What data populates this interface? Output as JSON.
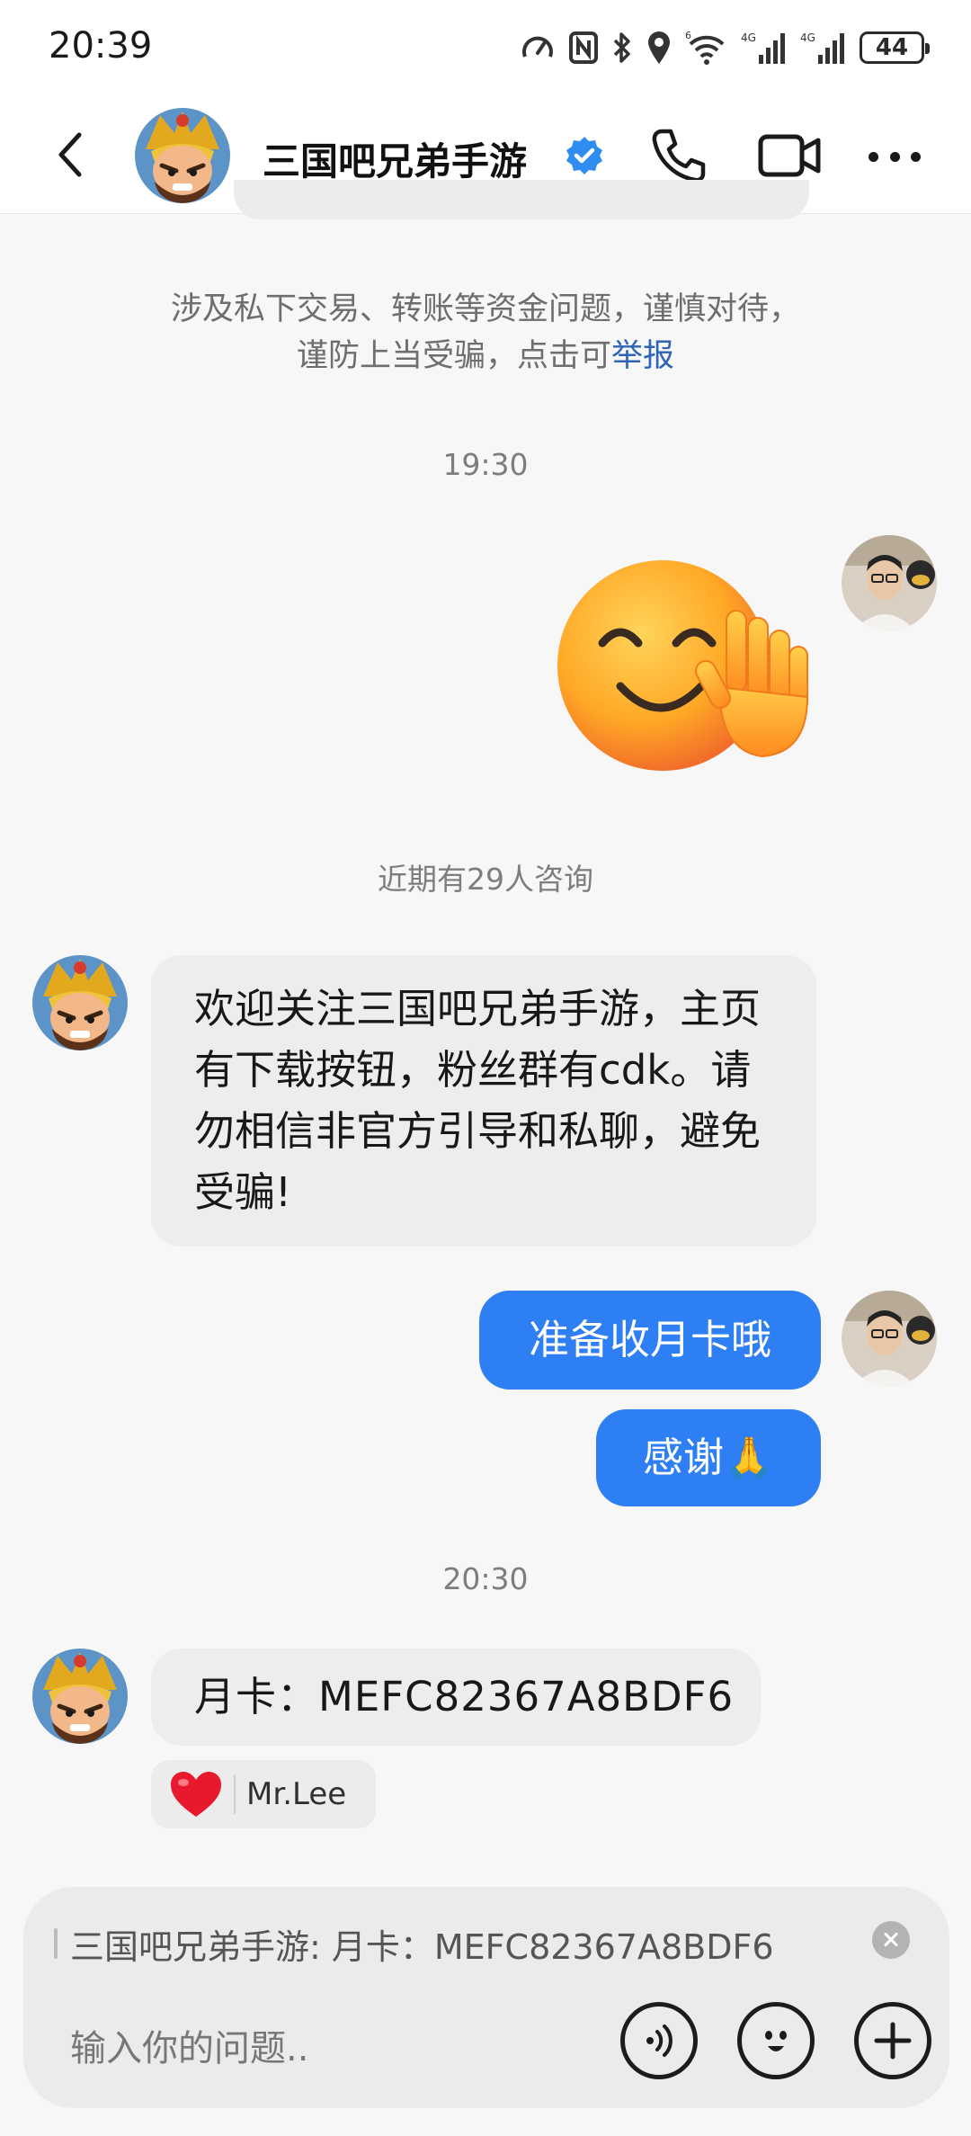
{
  "status_bar": {
    "time": "20:39",
    "network_1": "4G",
    "network_2": "4G",
    "wifi_badge": "6",
    "battery": "44",
    "icons": [
      "speed-icon",
      "nfc-icon",
      "bluetooth-icon",
      "location-icon",
      "wifi-icon",
      "signal-icon",
      "signal-icon",
      "battery-icon"
    ]
  },
  "header": {
    "title": "三国吧兄弟手游",
    "verified_color": "#2f8cf0",
    "icons": [
      "back-arrow-icon",
      "verified-badge-icon",
      "phone-call-icon",
      "video-call-icon",
      "more-dots-icon"
    ]
  },
  "chat": {
    "notice_text": "涉及私下交易、转账等资金问题，谨慎对待，谨防上当受骗，点击可",
    "notice_link": "举报",
    "timestamp_1": "19:30",
    "sticker": "waving-smile-emoji",
    "consult_note": "近期有29人咨询",
    "welcome_message": "欢迎关注三国吧兄弟手游，主页有下载按钮，粉丝群有cdk。请勿相信非官方引导和私聊，避免受骗!",
    "sent_message_1": "准备收月卡哦",
    "sent_message_2": "感谢🙏",
    "timestamp_2": "20:30",
    "code_message": "月卡：MEFC82367A8BDF6",
    "reaction": {
      "emoji": "heart-icon",
      "user": "Mr.Lee"
    },
    "accent_color": "#2d7ff3"
  },
  "composer": {
    "quote_text": "三国吧兄弟手游: 月卡：MEFC82367A8BDF6",
    "placeholder": "输入你的问题..",
    "icons": [
      "close-icon",
      "voice-icon",
      "emoji-icon",
      "plus-icon"
    ]
  }
}
